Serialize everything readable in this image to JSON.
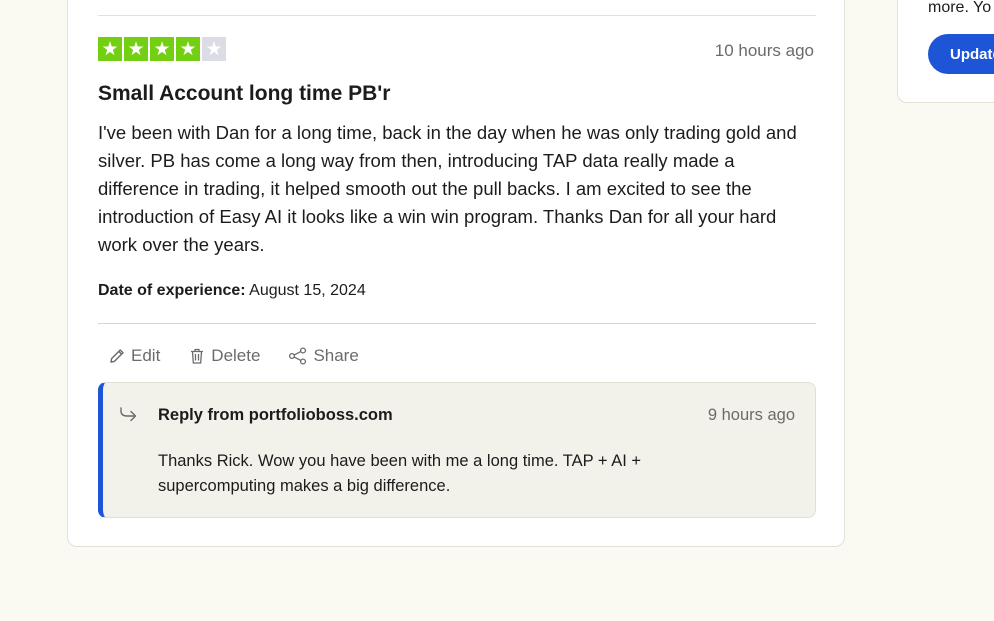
{
  "review": {
    "rating": 4,
    "max_rating": 5,
    "time": "10 hours ago",
    "title": "Small Account long time PB'r",
    "body": "I've been with Dan for a long time, back in the day when he was only trading gold and silver. PB has come a long way from then, introducing TAP data really made a difference in trading, it helped smooth out the pull backs. I am excited to see the introduction of Easy AI it looks like a win win program. Thanks Dan for all your hard work over the years.",
    "experience_label": "Date of experience:",
    "experience_date": "August 15, 2024"
  },
  "actions": {
    "edit": "Edit",
    "delete": "Delete",
    "share": "Share"
  },
  "reply": {
    "title": "Reply from portfolioboss.com",
    "time": "9 hours ago",
    "text": "Thanks Rick. Wow you have been with me a long time. TAP + AI + supercomputing makes a big difference."
  },
  "side": {
    "text": "more. Yo",
    "button": "Update"
  },
  "colors": {
    "star_filled": "#73cf11",
    "star_empty": "#dcdce6",
    "accent": "#1e55d6"
  }
}
